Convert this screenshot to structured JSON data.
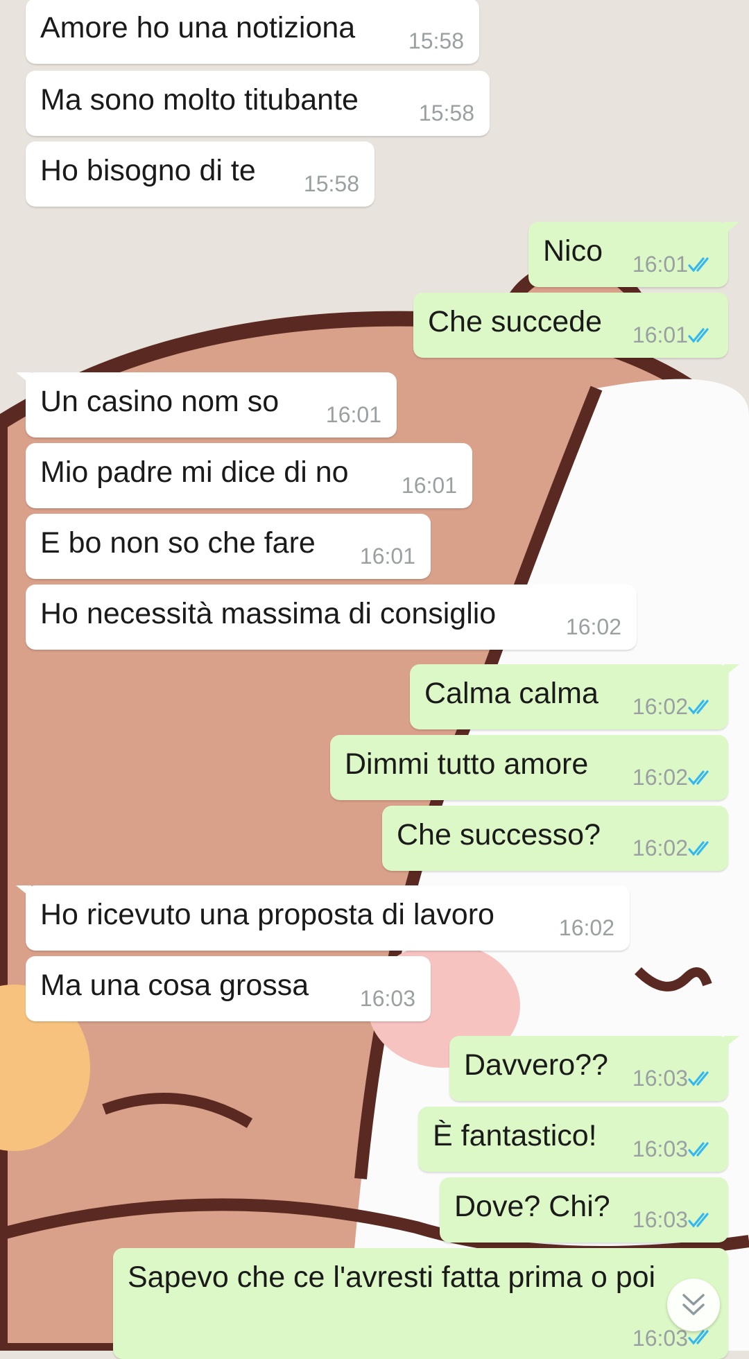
{
  "colors": {
    "incoming_bg": "#ffffff",
    "outgoing_bg": "#dcf8c6",
    "read_ticks": "#34b7f1",
    "time": "#9aa0a2"
  },
  "messages": [
    {
      "text": "Amore ho una notiziona",
      "time": "15:58",
      "dir": "in"
    },
    {
      "text": "Ma sono molto titubante",
      "time": "15:58",
      "dir": "in"
    },
    {
      "text": "Ho bisogno di te",
      "time": "15:58",
      "dir": "in"
    },
    {
      "text": "Nico",
      "time": "16:01",
      "dir": "out",
      "status": "read"
    },
    {
      "text": "Che succede",
      "time": "16:01",
      "dir": "out",
      "status": "read"
    },
    {
      "text": "Un casino nom so",
      "time": "16:01",
      "dir": "in"
    },
    {
      "text": "Mio padre mi dice di no",
      "time": "16:01",
      "dir": "in"
    },
    {
      "text": "E bo non so che fare",
      "time": "16:01",
      "dir": "in"
    },
    {
      "text": "Ho necessità massima di consiglio",
      "time": "16:02",
      "dir": "in"
    },
    {
      "text": "Calma calma",
      "time": "16:02",
      "dir": "out",
      "status": "read"
    },
    {
      "text": "Dimmi tutto amore",
      "time": "16:02",
      "dir": "out",
      "status": "read"
    },
    {
      "text": "Che successo?",
      "time": "16:02",
      "dir": "out",
      "status": "read"
    },
    {
      "text": "Ho ricevuto una proposta di lavoro",
      "time": "16:02",
      "dir": "in"
    },
    {
      "text": "Ma una cosa grossa",
      "time": "16:03",
      "dir": "in"
    },
    {
      "text": "Davvero??",
      "time": "16:03",
      "dir": "out",
      "status": "read"
    },
    {
      "text": "È fantastico!",
      "time": "16:03",
      "dir": "out",
      "status": "read"
    },
    {
      "text": "Dove? Chi?",
      "time": "16:03",
      "dir": "out",
      "status": "read"
    },
    {
      "text": "Sapevo che ce l'avresti fatta prima o poi",
      "time": "16:03",
      "dir": "out",
      "status": "read"
    }
  ],
  "scroll_down_icon": "double-chevron-down-icon"
}
